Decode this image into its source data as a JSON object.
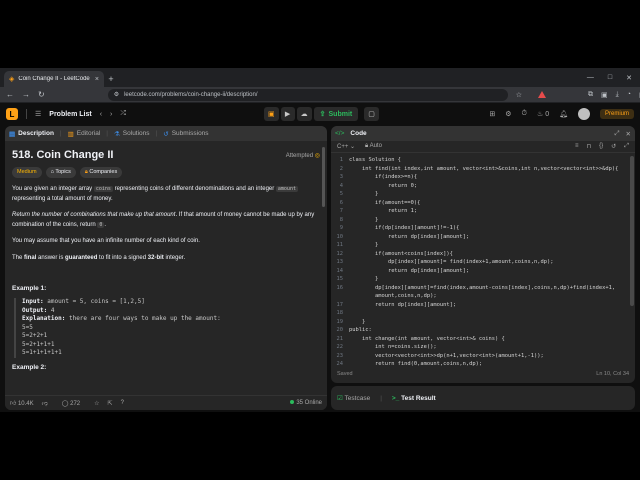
{
  "browser": {
    "tab_title": "Coin Change II - LeetCode",
    "tab_close": "×",
    "new_tab": "+",
    "url": "leetcode.com/problems/coin-change-ii/description/",
    "win_min": "—",
    "win_max": "□",
    "win_close": "✕"
  },
  "header": {
    "logo_letter": "L",
    "problem_list": "Problem List",
    "submit": "Submit",
    "streak": "0",
    "premium": "Premium"
  },
  "left_tabs": [
    {
      "label": "Description"
    },
    {
      "label": "Editorial"
    },
    {
      "label": "Solutions"
    },
    {
      "label": "Submissions"
    }
  ],
  "problem": {
    "title": "518. Coin Change II",
    "status": "Attempted",
    "difficulty": "Medium",
    "topics": "Topics",
    "companies": "Companies",
    "p1_a": "You are given an integer array ",
    "p1_code1": "coins",
    "p1_b": " representing coins of different denominations and an integer ",
    "p1_code2": "amount",
    "p1_c": " representing a total amount of money.",
    "p2_a": "Return the number of combinations that make up that amount",
    "p2_b": ". If that amount of money cannot be made up by any combination of the coins, return ",
    "p2_code": "0",
    "p2_c": ".",
    "p3": "You may assume that you have an infinite number of each kind of coin.",
    "p4_a": "The ",
    "p4_b": "final",
    "p4_c": " answer is ",
    "p4_d": "guaranteed",
    "p4_e": " to fit into a signed ",
    "p4_f": "32-bit",
    "p4_g": " integer.",
    "example1_title": "Example 1:",
    "ex_input_label": "Input:",
    "ex_input": " amount = 5, coins = [1,2,5]",
    "ex_output_label": "Output:",
    "ex_output": " 4",
    "ex_expl_label": "Explanation:",
    "ex_expl": " there are four ways to make up the amount:",
    "ex_l1": "5=5",
    "ex_l2": "5=2+2+1",
    "ex_l3": "5=2+1+1+1",
    "ex_l4": "5=1+1+1+1+1",
    "example2_title": "Example 2:"
  },
  "footer": {
    "likes": "10.4K",
    "comments": "272",
    "online": "35 Online"
  },
  "code": {
    "header": "Code",
    "language": "C++",
    "mode": "Auto",
    "saved": "Saved",
    "cursor": "Ln 10, Col 34",
    "lines": [
      {
        "n": "1",
        "t": "class Solution {"
      },
      {
        "n": "2",
        "t": "    int find(int index,int amount, vector<int>&coins,int n,vector<vector<int>>&dp){"
      },
      {
        "n": "3",
        "t": "        if(index>=n){"
      },
      {
        "n": "4",
        "t": "            return 0;"
      },
      {
        "n": "5",
        "t": "        }"
      },
      {
        "n": "6",
        "t": "        if(amount==0){"
      },
      {
        "n": "7",
        "t": "            return 1;"
      },
      {
        "n": "8",
        "t": "        }"
      },
      {
        "n": "9",
        "t": "        if(dp[index][amount]!=-1){"
      },
      {
        "n": "10",
        "t": "            return dp[index][amount];"
      },
      {
        "n": "11",
        "t": "        }"
      },
      {
        "n": "12",
        "t": "        if(amount<coins[index]){"
      },
      {
        "n": "13",
        "t": "            dp[index][amount]= find(index+1,amount,coins,n,dp);"
      },
      {
        "n": "14",
        "t": "            return dp[index][amount];"
      },
      {
        "n": "15",
        "t": "        }"
      },
      {
        "n": "16",
        "t": "        dp[index][amount]=find(index,amount-coins[index],coins,n,dp)+find(index+1,"
      },
      {
        "n": "",
        "t": "        amount,coins,n,dp);"
      },
      {
        "n": "17",
        "t": "        return dp[index][amount];"
      },
      {
        "n": "18",
        "t": ""
      },
      {
        "n": "19",
        "t": "    }"
      },
      {
        "n": "20",
        "t": "public:"
      },
      {
        "n": "21",
        "t": "    int change(int amount, vector<int>& coins) {"
      },
      {
        "n": "22",
        "t": "        int n=coins.size();"
      },
      {
        "n": "23",
        "t": "        vector<vector<int>>dp(n+1,vector<int>(amount+1,-1));"
      },
      {
        "n": "24",
        "t": "        return find(0,amount,coins,n,dp);"
      }
    ]
  },
  "bottom": {
    "testcase": "Testcase",
    "test_result": "Test Result"
  }
}
